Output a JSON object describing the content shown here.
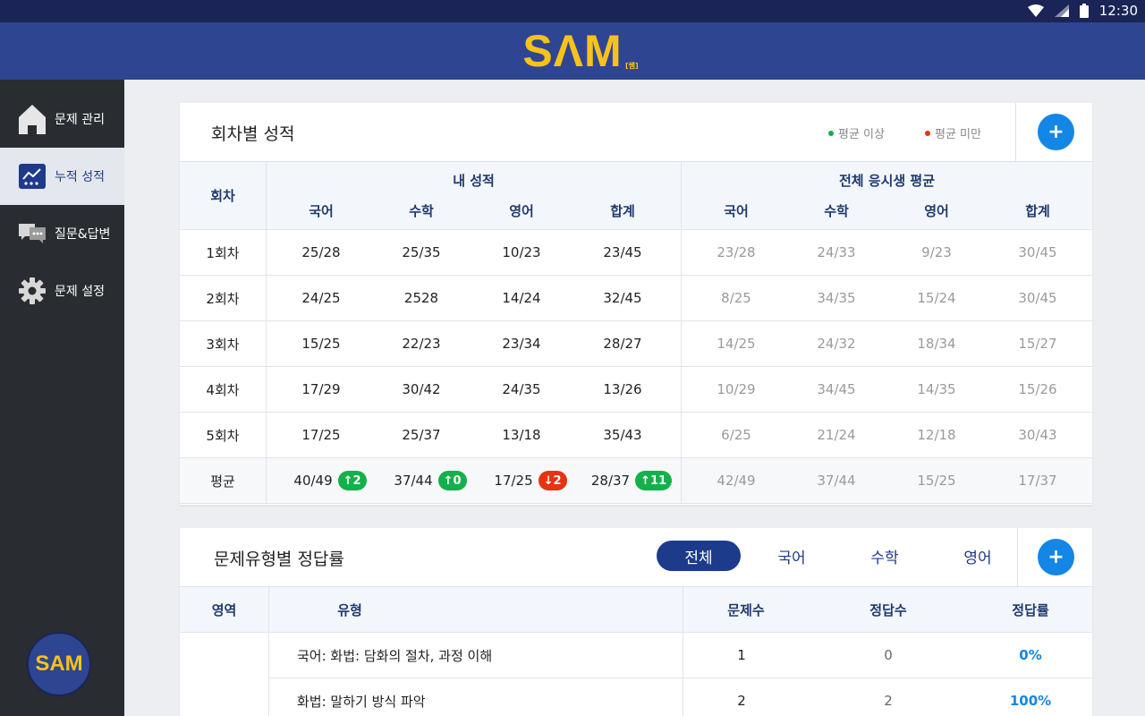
{
  "status_bar": {
    "time": "12:30"
  },
  "app": {
    "logo": "SΛM",
    "logo_sub": "[쌤]"
  },
  "sidebar": {
    "items": [
      {
        "label": "문제 관리",
        "icon": "home-icon",
        "active": false
      },
      {
        "label": "누적 성적",
        "icon": "chart-icon",
        "active": true
      },
      {
        "label": "질문&답변",
        "icon": "chat-icon",
        "active": false
      },
      {
        "label": "문제 설정",
        "icon": "gear-icon",
        "active": false
      }
    ],
    "badge": "SAM"
  },
  "score_card": {
    "title": "회차별 성적",
    "legend_above": "평균 이상",
    "legend_below": "평균 미만",
    "legend_above_color": "#13b14b",
    "legend_below_color": "#e63312",
    "round_header": "회차",
    "my_header": "내 성적",
    "all_header": "전체 응시생 평균",
    "subjects": [
      "국어",
      "수학",
      "영어",
      "합계"
    ],
    "rows": [
      {
        "round": "1회차",
        "mine": [
          "25/28",
          "25/35",
          "10/23",
          "23/45"
        ],
        "avg": [
          "23/28",
          "24/33",
          "9/23",
          "30/45"
        ]
      },
      {
        "round": "2회차",
        "mine": [
          "24/25",
          "2528",
          "14/24",
          "32/45"
        ],
        "avg": [
          "8/25",
          "34/35",
          "15/24",
          "30/45"
        ]
      },
      {
        "round": "3회차",
        "mine": [
          "15/25",
          "22/23",
          "23/34",
          "28/27"
        ],
        "avg": [
          "14/25",
          "24/32",
          "18/34",
          "15/27"
        ]
      },
      {
        "round": "4회차",
        "mine": [
          "17/29",
          "30/42",
          "24/35",
          "13/26"
        ],
        "avg": [
          "10/29",
          "34/45",
          "14/35",
          "15/26"
        ]
      },
      {
        "round": "5회차",
        "mine": [
          "17/25",
          "25/37",
          "13/18",
          "35/43"
        ],
        "avg": [
          "6/25",
          "21/24",
          "12/18",
          "30/43"
        ]
      }
    ],
    "average_row": {
      "label": "평균",
      "mine": [
        {
          "value": "40/49",
          "change": "2",
          "dir": "up"
        },
        {
          "value": "37/44",
          "change": "0",
          "dir": "up"
        },
        {
          "value": "17/25",
          "change": "2",
          "dir": "down"
        },
        {
          "value": "28/37",
          "change": "11",
          "dir": "up"
        }
      ],
      "avg": [
        "42/49",
        "37/44",
        "15/25",
        "17/37"
      ]
    }
  },
  "type_card": {
    "title": "문제유형별 정답률",
    "tabs": [
      {
        "label": "전체",
        "active": true
      },
      {
        "label": "국어",
        "active": false
      },
      {
        "label": "수학",
        "active": false
      },
      {
        "label": "영어",
        "active": false
      }
    ],
    "headers": {
      "area": "영역",
      "type": "유형",
      "count": "문제수",
      "correct": "정답수",
      "rate": "정답률"
    },
    "rows": [
      {
        "area": "",
        "type": "국어: 화법: 담화의 절차, 과정 이해",
        "count": "1",
        "correct": "0",
        "rate": "0%"
      },
      {
        "area": "",
        "type": "화법: 말하기 방식 파악",
        "count": "2",
        "correct": "2",
        "rate": "100%"
      }
    ]
  }
}
